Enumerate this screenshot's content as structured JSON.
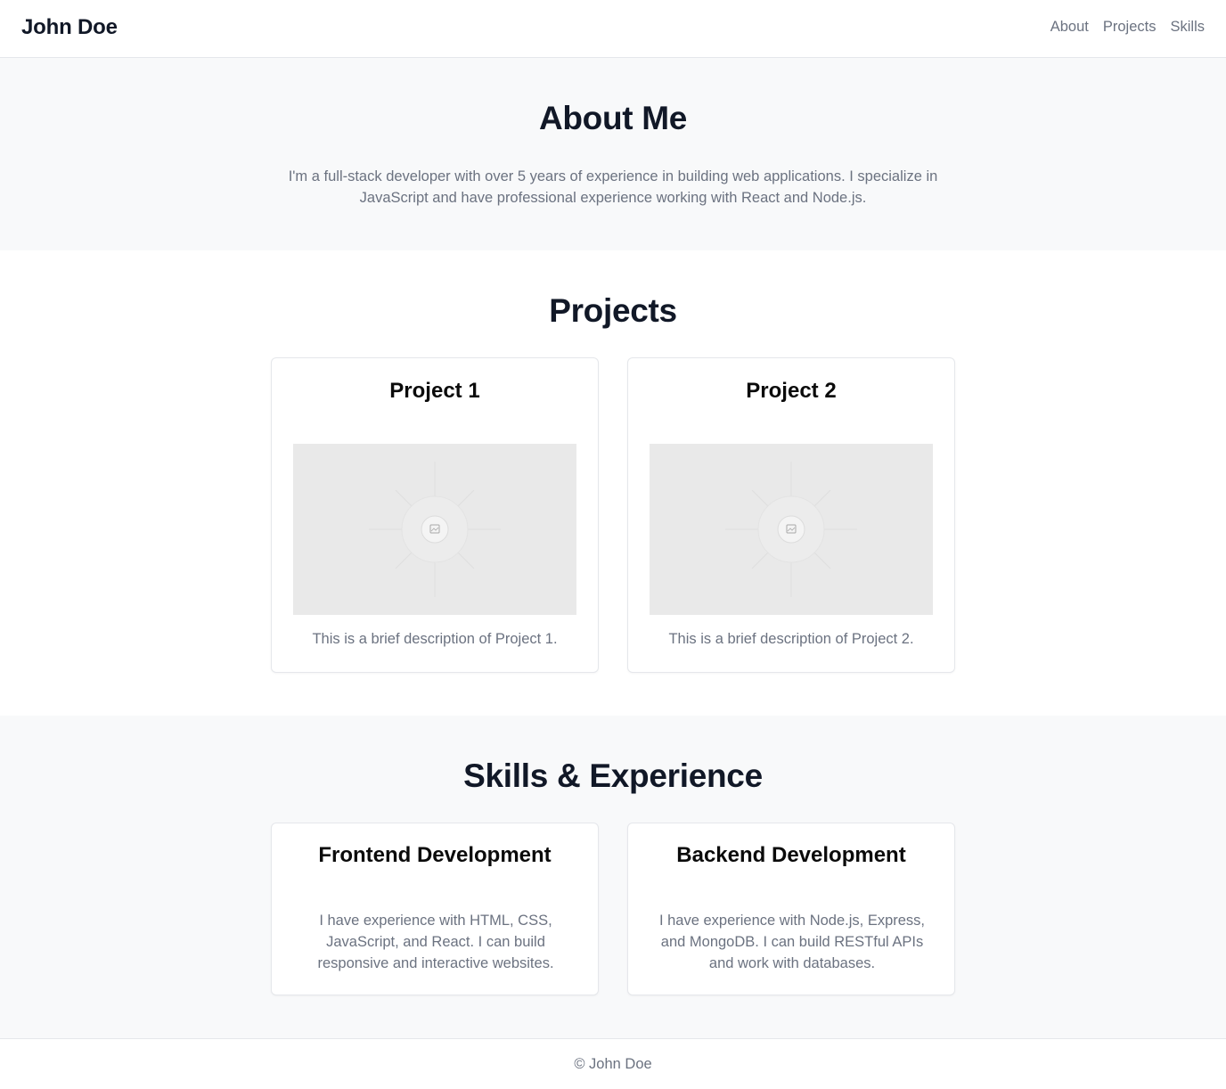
{
  "header": {
    "brand": "John Doe",
    "nav": [
      "About",
      "Projects",
      "Skills"
    ]
  },
  "about": {
    "title": "About Me",
    "text": "I'm a full-stack developer with over 5 years of experience in building web applications. I specialize in JavaScript and have professional experience working with React and Node.js."
  },
  "projects": {
    "title": "Projects",
    "items": [
      {
        "title": "Project 1",
        "image_icon": "image-placeholder-icon",
        "description": "This is a brief description of Project 1."
      },
      {
        "title": "Project 2",
        "image_icon": "image-placeholder-icon",
        "description": "This is a brief description of Project 2."
      }
    ]
  },
  "skills": {
    "title": "Skills & Experience",
    "items": [
      {
        "title": "Frontend Development",
        "description": "I have experience with HTML, CSS, JavaScript, and React. I can build responsive and interactive websites."
      },
      {
        "title": "Backend Development",
        "description": "I have experience with Node.js, Express, and MongoDB. I can build RESTful APIs and work with databases."
      }
    ]
  },
  "footer": {
    "text": "© John Doe"
  },
  "colors": {
    "text_dark": "#111827",
    "text_muted": "#6b7280",
    "section_alt_bg": "#f8f9fa",
    "border": "#e5e7eb",
    "placeholder_bg": "#e9e9e9"
  }
}
